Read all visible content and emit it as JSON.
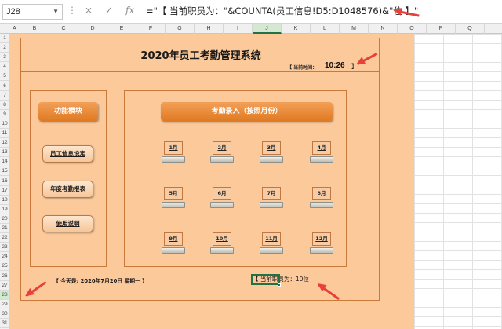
{
  "formula_bar": {
    "cell_ref": "J28",
    "dots_glyph": "⋮",
    "cancel_icon": "×",
    "enter_icon": "✓",
    "fx_label": "fx",
    "formula": "=\"【 当前职员为：\"&COUNTA(员工信息!D5:D1048576)&\"位 】\""
  },
  "columns": [
    "A",
    "B",
    "C",
    "D",
    "E",
    "F",
    "G",
    "H",
    "I",
    "J",
    "K",
    "L",
    "M",
    "N",
    "O",
    "P",
    "Q"
  ],
  "selected_column": "J",
  "rows": [
    "1",
    "2",
    "3",
    "4",
    "5",
    "6",
    "7",
    "8",
    "9",
    "10",
    "11",
    "12",
    "13",
    "14",
    "15",
    "16",
    "17",
    "18",
    "19",
    "20",
    "21",
    "22",
    "23",
    "24",
    "25",
    "26",
    "27",
    "28",
    "29",
    "30",
    "31"
  ],
  "selected_row": "28",
  "system": {
    "title": "2020年员工考勤管理系统",
    "time_label": "【 当前时间：",
    "time_value": "10:26",
    "time_close": "】"
  },
  "left_panel": {
    "header": "功能模块",
    "buttons": [
      "员工信息设定",
      "年度考勤报表",
      "使用说明"
    ]
  },
  "right_panel": {
    "header": "考勤录入（按照月份）",
    "months": [
      "1月",
      "2月",
      "3月",
      "4月",
      "5月",
      "6月",
      "7月",
      "8月",
      "9月",
      "10月",
      "11月",
      "12月"
    ]
  },
  "footer": {
    "today": "【 今天是: 2020年7月20日 星期一 】",
    "employee_count": "【 当前职员为：10位"
  },
  "colors": {
    "sheet_bg": "#fbc99a",
    "accent_orange": "#e07a22",
    "frame_border": "#c97a3a",
    "annotation_red": "#e8403a",
    "selection_green": "#217346"
  }
}
